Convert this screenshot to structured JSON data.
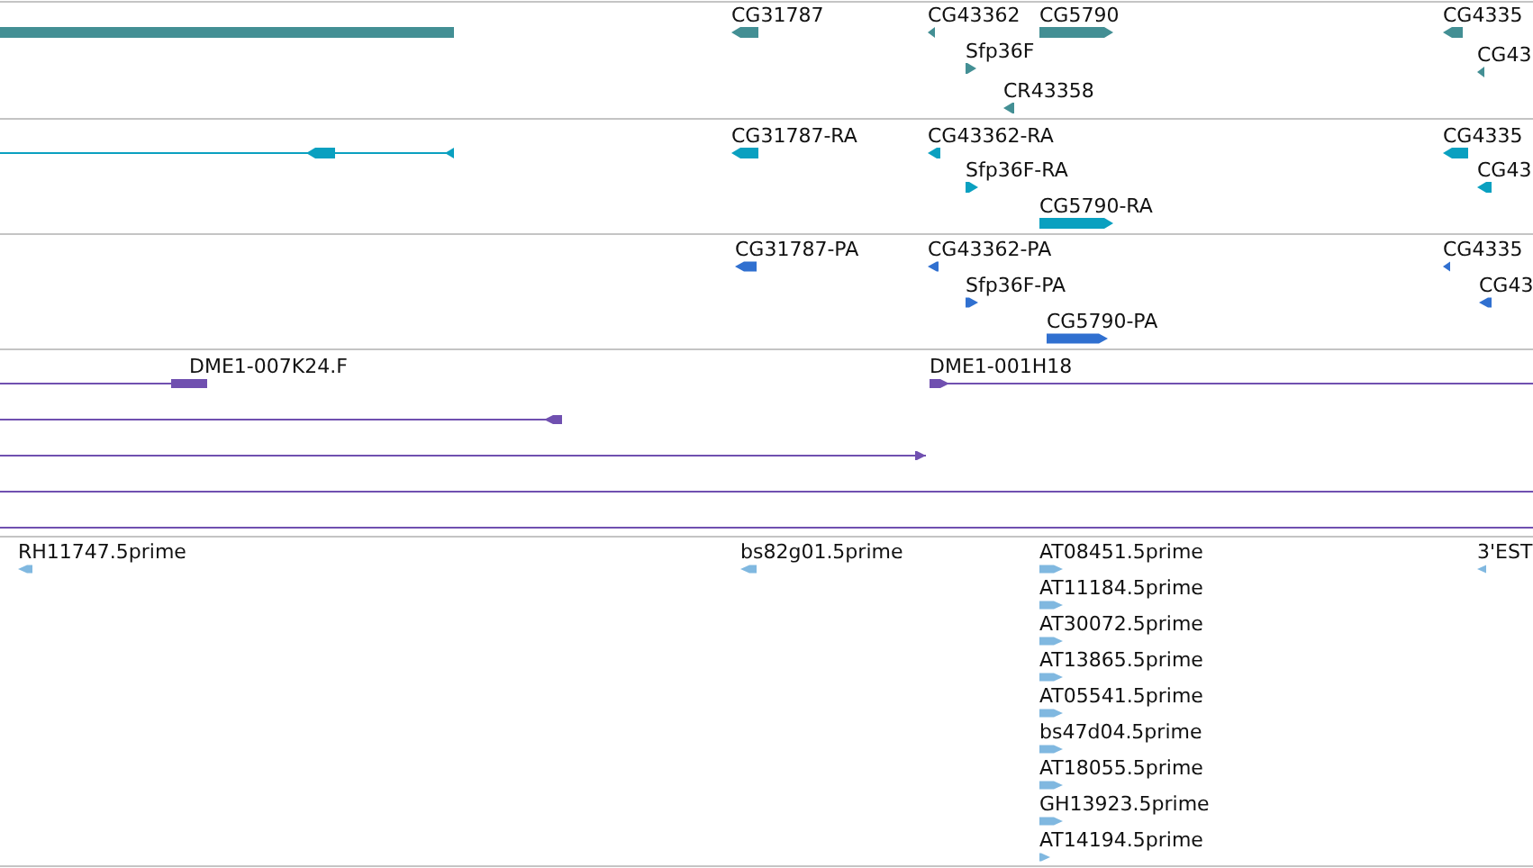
{
  "tracks": [
    {
      "kind": "gene",
      "color": "#438f94",
      "features": [
        {
          "kind": "block"
        },
        {
          "label": "CG31787",
          "kind": "reverse"
        },
        {
          "label": "CG43362",
          "kind": "reverse"
        },
        {
          "label": "CG5790",
          "kind": "forward"
        },
        {
          "label": "Sfp36F",
          "kind": "forward"
        },
        {
          "label": "CR43358",
          "kind": "reverse"
        },
        {
          "label": "CG4335",
          "kind": "reverse"
        },
        {
          "label": "CG43",
          "kind": "reverse"
        }
      ]
    },
    {
      "kind": "transcript",
      "color": "#0aa0c0",
      "features": [
        {
          "kind": "reverse"
        },
        {
          "label": "CG31787-RA",
          "kind": "reverse"
        },
        {
          "label": "CG43362-RA",
          "kind": "reverse"
        },
        {
          "label": "Sfp36F-RA",
          "kind": "forward"
        },
        {
          "label": "CG5790-RA",
          "kind": "forward"
        },
        {
          "label": "CG4335",
          "kind": "reverse"
        },
        {
          "label": "CG43",
          "kind": "reverse"
        }
      ]
    },
    {
      "kind": "protein",
      "color": "#3070d0",
      "features": [
        {
          "label": "CG31787-PA",
          "kind": "reverse"
        },
        {
          "label": "CG43362-PA",
          "kind": "reverse"
        },
        {
          "label": "Sfp36F-PA",
          "kind": "forward"
        },
        {
          "label": "CG5790-PA",
          "kind": "forward"
        },
        {
          "label": "CG4335",
          "kind": "reverse"
        },
        {
          "label": "CG43",
          "kind": "reverse"
        }
      ]
    },
    {
      "kind": "alignment",
      "color": "#7050b0",
      "features": [
        {
          "label": "DME1-007K24.F",
          "kind": "block"
        },
        {
          "label": "DME1-001H18",
          "kind": "forward"
        },
        {
          "kind": "reverse"
        },
        {
          "kind": "forward"
        },
        {
          "kind": "line"
        },
        {
          "kind": "line"
        }
      ]
    },
    {
      "kind": "est",
      "color": "#80b8e0",
      "features": [
        {
          "label": "RH11747.5prime",
          "kind": "reverse"
        },
        {
          "label": "bs82g01.5prime",
          "kind": "reverse"
        },
        {
          "label": "AT08451.5prime",
          "kind": "forward"
        },
        {
          "label": "AT11184.5prime",
          "kind": "forward"
        },
        {
          "label": "AT30072.5prime",
          "kind": "forward"
        },
        {
          "label": "AT13865.5prime",
          "kind": "forward"
        },
        {
          "label": "AT05541.5prime",
          "kind": "forward"
        },
        {
          "label": "bs47d04.5prime",
          "kind": "forward"
        },
        {
          "label": "AT18055.5prime",
          "kind": "forward"
        },
        {
          "label": "GH13923.5prime",
          "kind": "forward"
        },
        {
          "label": "AT14194.5prime",
          "kind": "forward"
        },
        {
          "label": "3'EST",
          "kind": "reverse"
        }
      ]
    }
  ]
}
